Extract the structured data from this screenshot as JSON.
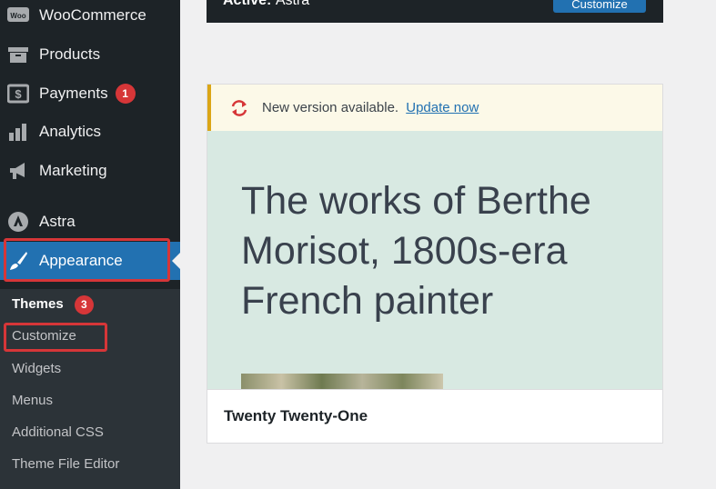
{
  "sidebar": {
    "items": [
      {
        "label": "WooCommerce",
        "icon": "woo-icon"
      },
      {
        "label": "Products",
        "icon": "archive-icon"
      },
      {
        "label": "Payments",
        "icon": "money-icon",
        "badge": "1"
      },
      {
        "label": "Analytics",
        "icon": "bar-chart-icon"
      },
      {
        "label": "Marketing",
        "icon": "megaphone-icon"
      },
      {
        "label": "Astra",
        "icon": "astra-icon"
      },
      {
        "label": "Appearance",
        "icon": "paintbrush-icon"
      }
    ],
    "submenu": [
      {
        "label": "Themes",
        "badge": "3"
      },
      {
        "label": "Customize"
      },
      {
        "label": "Widgets"
      },
      {
        "label": "Menus"
      },
      {
        "label": "Additional CSS"
      },
      {
        "label": "Theme File Editor"
      }
    ]
  },
  "active_theme": {
    "active_prefix": "Active:",
    "name": "Astra",
    "customize_label": "Customize"
  },
  "theme_card": {
    "notice_text": "New version available.",
    "notice_link": "Update now",
    "headline": "The works of Berthe Morisot, 1800s-era French painter",
    "theme_name": "Twenty Twenty-One"
  },
  "colors": {
    "sidebar_bg": "#1d2327",
    "submenu_bg": "#2c3338",
    "accent": "#2271b1",
    "badge": "#d63638",
    "highlight_outline": "#d63638",
    "notice_border": "#dba617"
  }
}
